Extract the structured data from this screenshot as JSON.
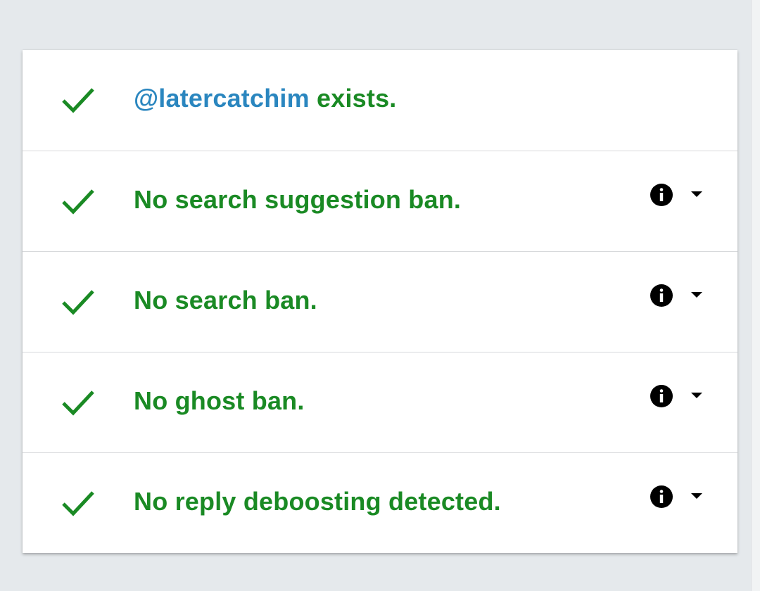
{
  "colors": {
    "success": "#1a8a24",
    "link": "#2a86bf",
    "background": "#e5e9ec",
    "card": "#ffffff"
  },
  "results": [
    {
      "handle": "@latercatchim",
      "label": " exists.",
      "icon": "check-icon",
      "has_details": false
    },
    {
      "label": "No search suggestion ban.",
      "icon": "check-icon",
      "has_details": true
    },
    {
      "label": "No search ban.",
      "icon": "check-icon",
      "has_details": true
    },
    {
      "label": "No ghost ban.",
      "icon": "check-icon",
      "has_details": true
    },
    {
      "label": "No reply deboosting detected.",
      "icon": "check-icon",
      "has_details": true
    }
  ]
}
